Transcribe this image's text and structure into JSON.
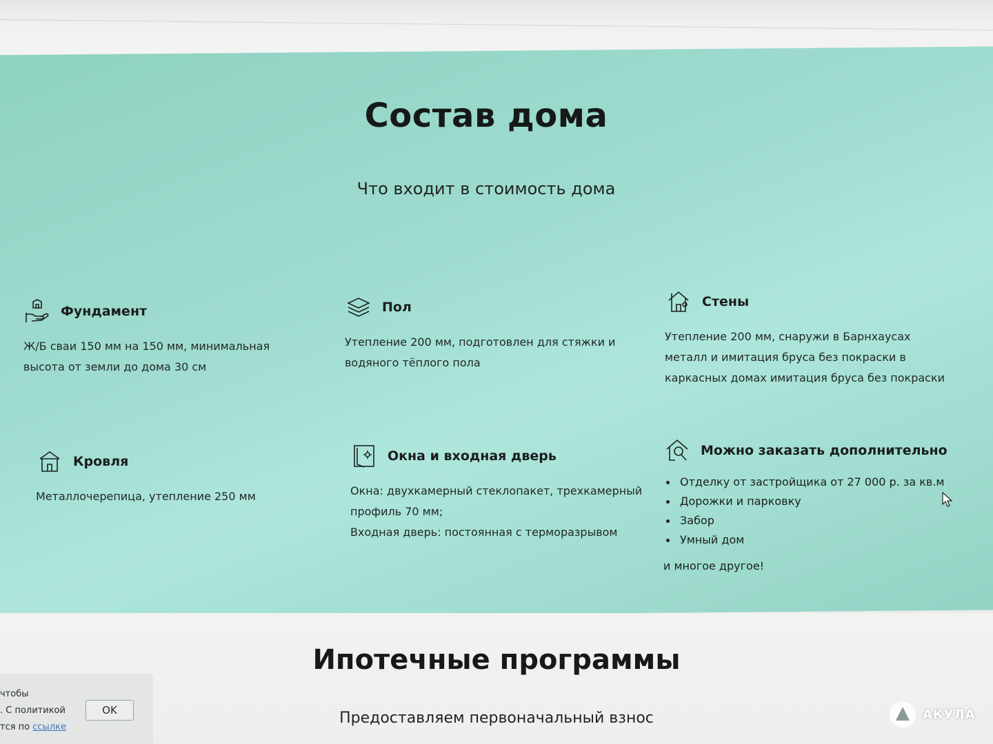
{
  "composition": {
    "title": "Состав дома",
    "subtitle": "Что входит в стоимость дома",
    "items": [
      {
        "icon": "foundation-icon",
        "title": "Фундамент",
        "lines": [
          "Ж/Б сваи 150 мм на 150 мм, минимальная",
          "высота от земли до дома 30 см"
        ]
      },
      {
        "icon": "floor-layers-icon",
        "title": "Пол",
        "lines": [
          "Утепление 200 мм, подготовлен для стяжки и",
          "водяного тёплого пола"
        ]
      },
      {
        "icon": "walls-house-icon",
        "title": "Стены",
        "lines": [
          "Утепление 200 мм, снаружи в Барнхаусах",
          "металл и имитация бруса без покраски в",
          "каркасных домах имитация бруса без покраски"
        ]
      },
      {
        "icon": "roof-house-icon",
        "title": "Кровля",
        "lines": [
          "Металлочерепица, утепление 250 мм"
        ]
      },
      {
        "icon": "window-door-icon",
        "title": "Окна и входная дверь",
        "lines": [
          "Окна: двухкамерный стеклопакет, трехкамерный",
          "профиль 70 мм;",
          "Входная дверь: постоянная с терморазрывом"
        ]
      },
      {
        "icon": "house-search-icon",
        "title": "Можно заказать дополнительно",
        "list": [
          "Отделку от застройщика от 27 000 р. за кв.м",
          "Дорожки и парковку",
          "Забор",
          "Умный дом"
        ],
        "footer": "и многое другое!"
      }
    ]
  },
  "mortgage": {
    "title": "Ипотечные программы",
    "text": "Предоставляем первоначальный взнос"
  },
  "cookie": {
    "line1": "чтобы",
    "line2": ". С политикой",
    "line3_prefix": "тся по ",
    "link_label": "ссылке",
    "ok_label": "OK"
  },
  "watermark": {
    "label": "АКУЛА"
  }
}
